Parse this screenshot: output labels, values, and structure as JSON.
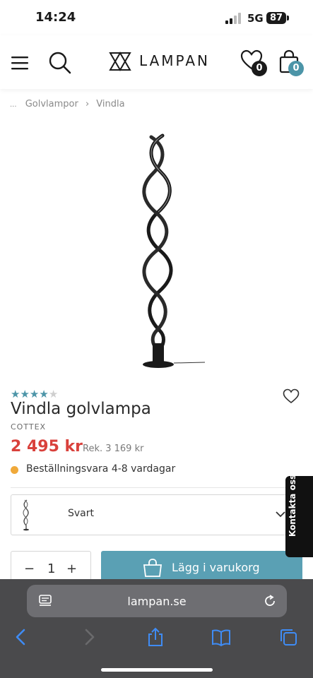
{
  "status": {
    "time": "14:24",
    "network": "5G",
    "battery": "87"
  },
  "header": {
    "logo_text": "LAMPAN",
    "wishlist_count": "0",
    "cart_count": "0",
    "badge_color": "#4c95a8"
  },
  "breadcrumb": {
    "ellipsis": "...",
    "items": [
      "Golvlampor",
      "Vindla"
    ]
  },
  "product": {
    "rating_stars": 4,
    "rating_max": 5,
    "title": "Vindla golvlampa",
    "brand": "COTTEX",
    "price": "2 495 kr",
    "rek_price": "Rek. 3 169 kr",
    "availability": "Beställningsvara 4-8 vardagar",
    "price_color": "#d9413c",
    "availability_color": "#f0a93a"
  },
  "variant": {
    "selected": "Svart"
  },
  "quantity": {
    "minus": "−",
    "value": "1",
    "plus": "+"
  },
  "add_to_cart": {
    "label": "Lägg i varukorg",
    "color": "#5aa0b4"
  },
  "contact": {
    "label": "Kontakta oss"
  },
  "browser": {
    "url": "lampan.se"
  }
}
